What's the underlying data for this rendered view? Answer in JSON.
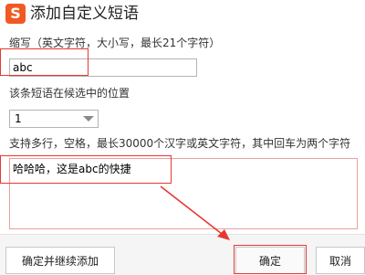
{
  "dialog": {
    "title": "添加自定义短语",
    "logo_glyph": "S",
    "logo_color": "#f05a22"
  },
  "abbr": {
    "label": "缩写（英文字符，大小写，最长21个字符）",
    "value": "abc"
  },
  "position": {
    "label": "该条短语在候选中的位置",
    "selected": "1"
  },
  "content": {
    "label": "支持多行，空格，最长30000个汉字或英文字符，其中回车为两个字符",
    "value": "哈哈哈，这是abc的快捷"
  },
  "buttons": {
    "continue_label": "确定并继续添加",
    "ok_label": "确定",
    "cancel_label": "取消"
  },
  "annotation": {
    "color": "#e53935"
  }
}
